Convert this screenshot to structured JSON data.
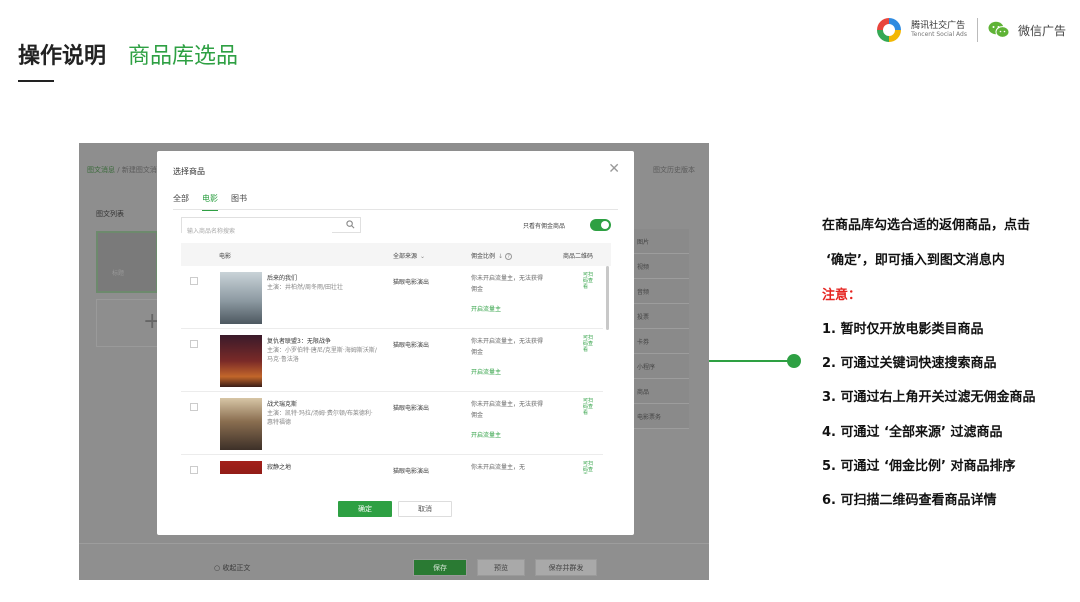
{
  "header": {
    "title": "操作说明",
    "subtitle": "商品库选品"
  },
  "logos": {
    "tencent_cn": "腾讯社交广告",
    "tencent_en": "Tencent Social Ads",
    "wechat": "微信广告"
  },
  "background": {
    "breadcrumb_home": "图文消息",
    "breadcrumb_current": "新建图文消息",
    "top_right": "图文历史版本",
    "list_title": "图文列表",
    "card_label": "标题",
    "side_items": [
      "图片",
      "视频",
      "音频",
      "投票",
      "卡券",
      "小程序",
      "商品",
      "电影票务"
    ],
    "radio_label": "收起正文",
    "buttons": {
      "save": "保存",
      "preview": "预览",
      "save_send": "保存并群发"
    }
  },
  "dialog": {
    "title": "选择商品",
    "tabs": [
      "全部",
      "电影",
      "图书"
    ],
    "active_tab": 1,
    "search_placeholder": "输入商品名称搜索",
    "toggle_label": "只看有佣金商品",
    "toggle_on": true,
    "columns": {
      "movie": "电影",
      "source": "全部来源",
      "commission": "佣金比例",
      "qr": "商品二维码"
    },
    "rows": [
      {
        "title": "后来的我们",
        "cast": "主演：井柏然/周冬雨/田壮壮",
        "source": "猫眼电影演出",
        "commission": "你未开启流量主，无法获得佣金",
        "link": "开启流量主",
        "qr": "可扫码查看",
        "poster_color": "#a7b3b9"
      },
      {
        "title": "复仇者联盟3：无限战争",
        "cast": "主演：小罗伯特·唐尼/克里斯·海姆斯沃斯/马克·鲁法洛",
        "source": "猫眼电影演出",
        "commission": "你未开启流量主，无法获得佣金",
        "link": "开启流量主",
        "qr": "可扫码查看",
        "poster_color": "#5b1f2a"
      },
      {
        "title": "战犬瑞克斯",
        "cast": "主演：凯特·玛拉/汤姆·费尔顿/布莱德利·惠特福德",
        "source": "猫眼电影演出",
        "commission": "你未开启流量主，无法获得佣金",
        "link": "开启流量主",
        "qr": "可扫码查看",
        "poster_color": "#6d5a45"
      },
      {
        "title": "寂静之地",
        "cast": "",
        "source": "猫眼电影演出",
        "commission": "你未开启流量主，无",
        "link": "",
        "qr": "可扫码查看",
        "poster_color": "#8a1c16"
      }
    ],
    "confirm": "确定",
    "cancel": "取消"
  },
  "notes": {
    "line1": "在商品库勾选合适的返佣商品，点击",
    "line2": "‘确定’，即可插入到图文消息内",
    "attention": "注意：",
    "items": [
      "1.  暂时仅开放电影类目商品",
      "2.  可通过关键词快速搜索商品",
      "3.  可通过右上角开关过滤无佣金商品",
      "4.  可通过 ‘全部来源’ 过滤商品",
      "5.  可通过 ‘佣金比例’ 对商品排序",
      "6.  可扫描二维码查看商品详情"
    ]
  },
  "colors": {
    "accent": "#2ea043",
    "attention": "#e52420"
  }
}
